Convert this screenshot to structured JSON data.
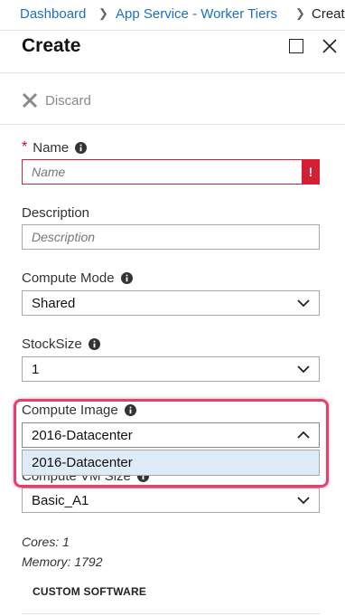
{
  "breadcrumb": {
    "items": [
      "Dashboard",
      "App Service - Worker Tiers"
    ],
    "current": "Create"
  },
  "header": {
    "title": "Create"
  },
  "toolbar": {
    "discard_label": "Discard"
  },
  "form": {
    "name": {
      "label": "Name",
      "required_mark": "*",
      "placeholder": "Name",
      "error_badge": "!"
    },
    "description": {
      "label": "Description",
      "placeholder": "Description"
    },
    "compute_mode": {
      "label": "Compute Mode",
      "value": "Shared"
    },
    "stock_size": {
      "label": "StockSize",
      "value": "1"
    },
    "compute_image": {
      "label": "Compute Image",
      "value": "2016-Datacenter",
      "options": [
        "2016-Datacenter"
      ]
    },
    "compute_vm_size": {
      "label": "Compute VM Size",
      "value": "Basic_A1"
    }
  },
  "vm_info": {
    "cores": "Cores: 1",
    "memory": "Memory: 1792"
  },
  "custom_software": {
    "heading": "CUSTOM SOFTWARE"
  },
  "colors": {
    "link": "#1f6fc0",
    "error": "#d51f34",
    "highlight": "#e93e6b",
    "selected_option": "#ddecf8"
  }
}
